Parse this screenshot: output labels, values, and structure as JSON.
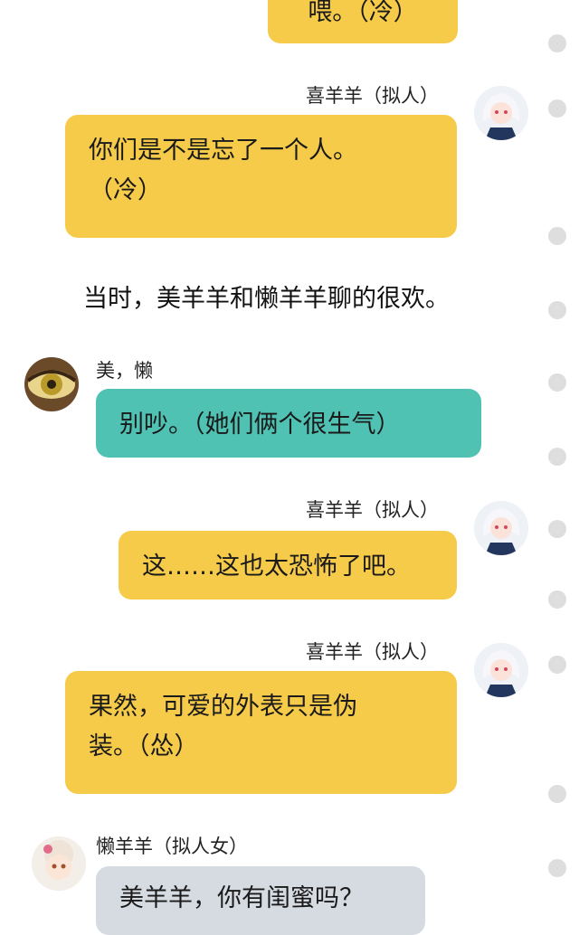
{
  "messages": [
    {
      "sender": "",
      "text": "喂。（冷）"
    },
    {
      "sender": "喜羊羊（拟人）",
      "line1": "你们是不是忘了一个人。",
      "line2": "（冷）"
    },
    {
      "sender": "美，懒",
      "text": "别吵。（她们俩个很生气）"
    },
    {
      "sender": "喜羊羊（拟人）",
      "text": "这……这也太恐怖了吧。"
    },
    {
      "sender": "喜羊羊（拟人）",
      "line1": "果然，可爱的外表只是伪",
      "line2": "装。（怂）"
    },
    {
      "sender": "懒羊羊（拟人女）",
      "text": "美羊羊，你有闺蜜吗？"
    }
  ],
  "narration": "当时，美羊羊和懒羊羊聊的很欢。",
  "colors": {
    "yellow": "#f6cb4a",
    "teal": "#4fc2b3",
    "grey": "#d6dbe2"
  },
  "icons": [
    "avatar-xiyangyang",
    "avatar-eye",
    "avatar-lanyangyang",
    "timeline-dot"
  ]
}
